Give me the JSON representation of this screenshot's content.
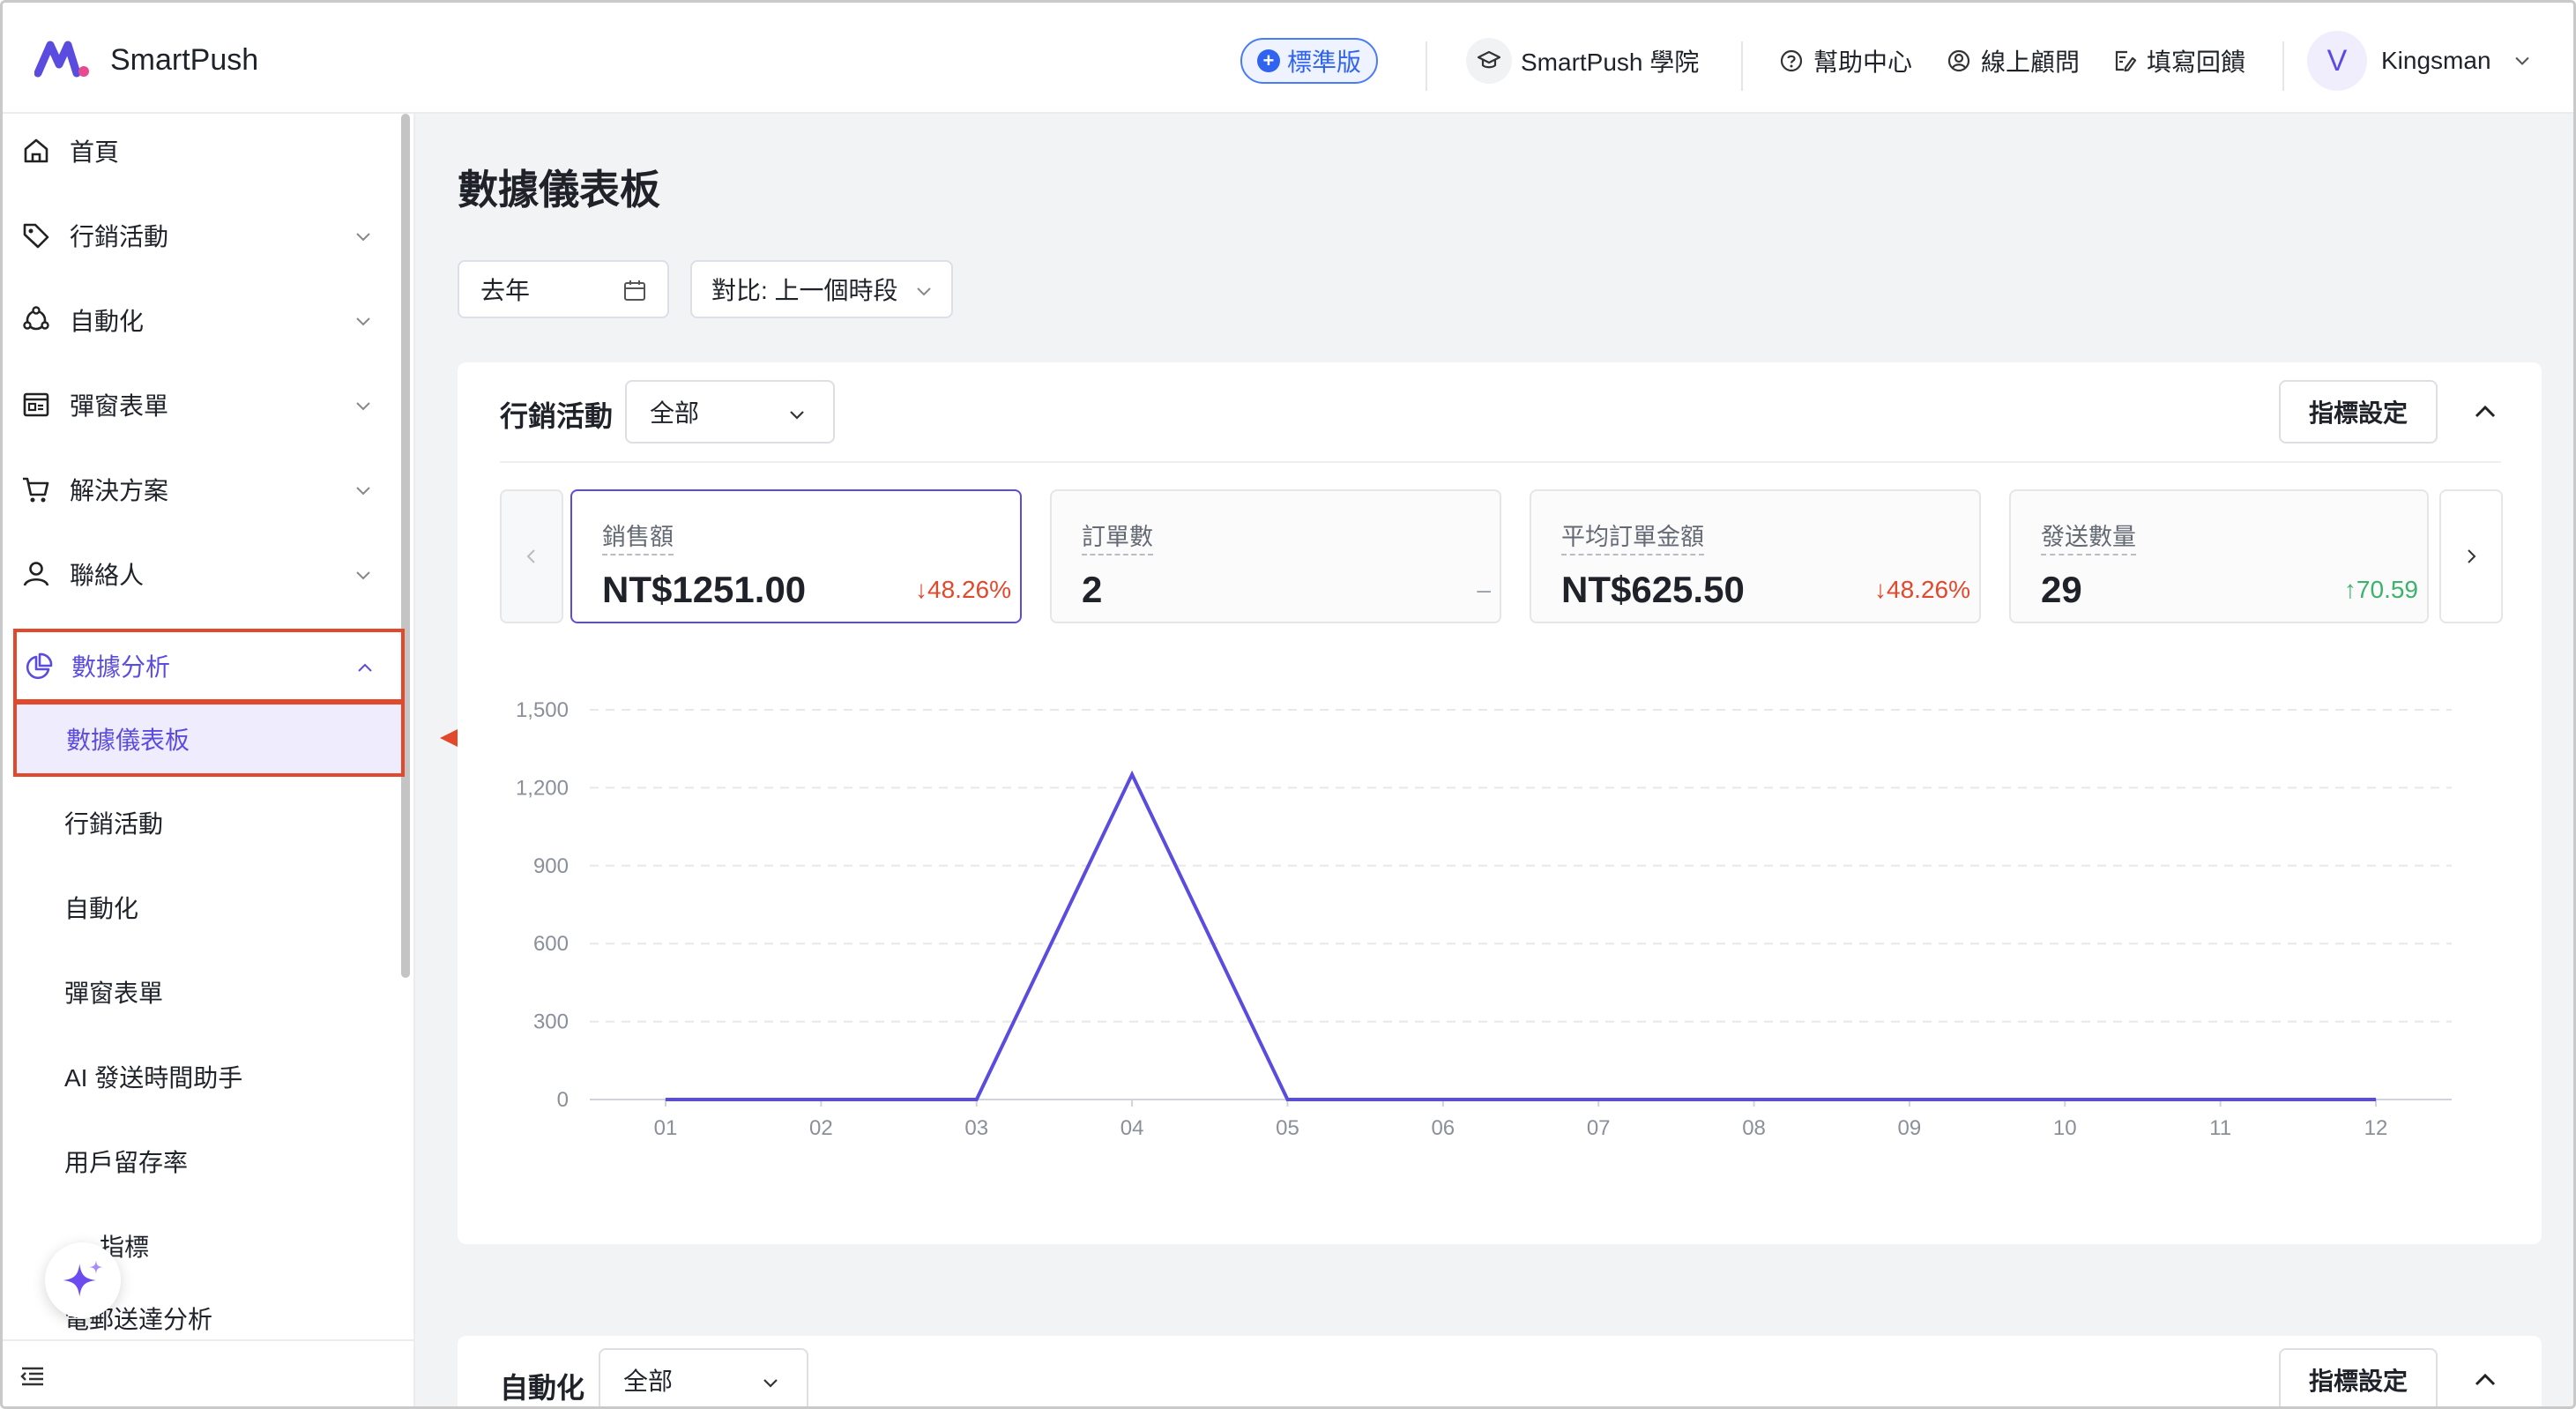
{
  "header": {
    "brand": "SmartPush",
    "plan_badge": "標準版",
    "academy": "SmartPush 學院",
    "help_center": "幫助中心",
    "online_consultant": "線上顧問",
    "feedback": "填寫回饋",
    "avatar_letter": "V",
    "user_name": "Kingsman"
  },
  "sidebar": {
    "items": [
      {
        "label": "首頁",
        "icon": "home-icon"
      },
      {
        "label": "行銷活動",
        "icon": "tag-icon"
      },
      {
        "label": "自動化",
        "icon": "automation-icon"
      },
      {
        "label": "彈窗表單",
        "icon": "form-icon"
      },
      {
        "label": "解決方案",
        "icon": "cart-icon"
      },
      {
        "label": "聯絡人",
        "icon": "user-icon"
      },
      {
        "label": "數據分析",
        "icon": "pie-chart-icon"
      }
    ],
    "analytics_sub": [
      "數據儀表板",
      "行銷活動",
      "自動化",
      "彈窗表單",
      "AI 發送時間助手",
      "用戶留存率",
      "指標",
      "電郵送達分析"
    ]
  },
  "main": {
    "title": "數據儀表板",
    "date_filter": "去年",
    "compare_filter": "對比: 上一個時段",
    "marketing": {
      "title": "行銷活動",
      "select_value": "全部",
      "metric_settings": "指標設定",
      "kpis": [
        {
          "label": "銷售額",
          "value": "NT$1251.00",
          "change": "↓48.26%",
          "trend": "down"
        },
        {
          "label": "訂單數",
          "value": "2",
          "change": "–",
          "trend": "flat"
        },
        {
          "label": "平均訂單金額",
          "value": "NT$625.50",
          "change": "↓48.26%",
          "trend": "down"
        },
        {
          "label": "發送數量",
          "value": "29",
          "change": "↑70.59",
          "trend": "up"
        }
      ]
    },
    "automation": {
      "title": "自動化",
      "select_value": "全部",
      "metric_settings": "指標設定"
    }
  },
  "colors": {
    "accent": "#5b4ce0",
    "down": "#e2482c",
    "up": "#3bb36a",
    "highlight_box": "#e2482c"
  },
  "chart_data": {
    "type": "line",
    "x": [
      "01",
      "02",
      "03",
      "04",
      "05",
      "06",
      "07",
      "08",
      "09",
      "10",
      "11",
      "12"
    ],
    "series": [
      {
        "values": [
          0,
          0,
          0,
          1251,
          0,
          0,
          0,
          0,
          0,
          0,
          0,
          0
        ]
      }
    ],
    "yticks": [
      "0",
      "300",
      "600",
      "900",
      "1,200",
      "1,500"
    ],
    "ylim": [
      0,
      1500
    ],
    "grid": true,
    "color": "#5b4ce0"
  }
}
